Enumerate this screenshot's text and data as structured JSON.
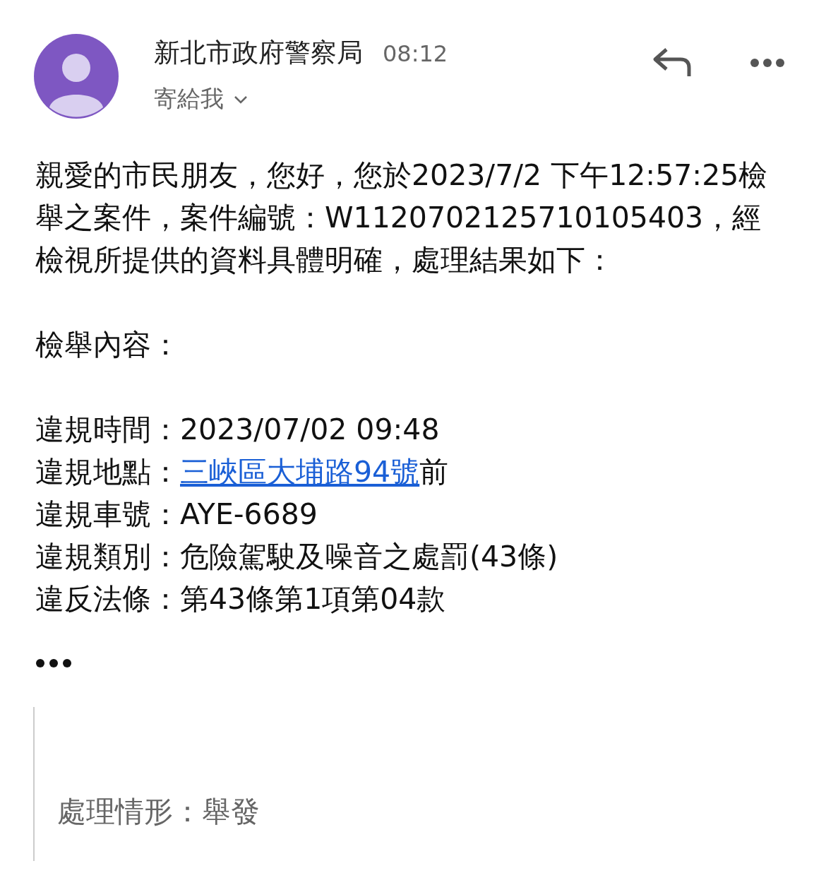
{
  "sender": {
    "name": "新北市政府警察局",
    "time": "08:12",
    "recipient": "寄給我"
  },
  "body": {
    "intro": "親愛的市民朋友，您好，您於2023/7/2 下午12:57:25檢舉之案件，案件編號：W1120702125710105403，經檢視所提供的資料具體明確，處理結果如下：",
    "section_title": "檢舉內容：",
    "fields": [
      {
        "kind": "text",
        "label": "違規時間：",
        "value": "2023/07/02 09:48"
      },
      {
        "kind": "link",
        "label": "違規地點：",
        "link": "三峽區大埔路94號",
        "value": "前"
      },
      {
        "kind": "text",
        "label": "違規車號：",
        "value": "AYE-6689"
      },
      {
        "kind": "text",
        "label": "違規類別：",
        "value": "危險駕駛及噪音之處罰(43條)"
      },
      {
        "kind": "text",
        "label": "違反法條：",
        "value": "第43條第1項第04款"
      }
    ]
  },
  "quote": {
    "text": "處理情形：舉發"
  }
}
